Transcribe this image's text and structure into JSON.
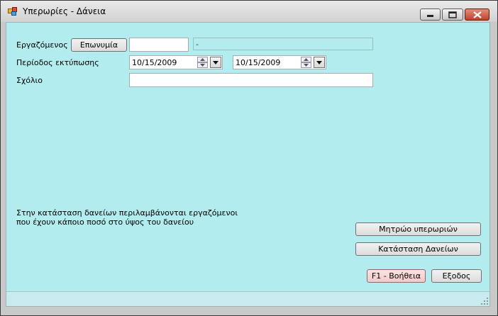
{
  "window": {
    "title": "Υπερωρίες - Δάνεια",
    "app_icon": "colored-blocks-icon",
    "controls": [
      "minimize-icon",
      "maximize-icon",
      "close-icon"
    ]
  },
  "form": {
    "employee_label": "Εργαζόμενος",
    "surname_button": "Επωνυμία",
    "employee_code_value": "",
    "employee_name_value": "-",
    "period_label": "Περίοδος εκτύπωσης",
    "date_from": "10/15/2009",
    "date_to": "10/15/2009",
    "comment_label": "Σχόλιο",
    "comment_value": ""
  },
  "note": {
    "line1": "Στην κατάσταση δανείων περιλαμβάνονται εργαζόμενοι",
    "line2": "που έχουν κάποιο ποσό στο ύψος του δανείου"
  },
  "actions": {
    "overtime_register": "Μητρώο υπερωριών",
    "loans_statement": "Κατάσταση Δανείων",
    "help": "F1 - Βοήθεια",
    "exit": "Εξοδος"
  },
  "colors": {
    "client_background": "#b3ecee",
    "help_button": "#f3c9c9"
  }
}
